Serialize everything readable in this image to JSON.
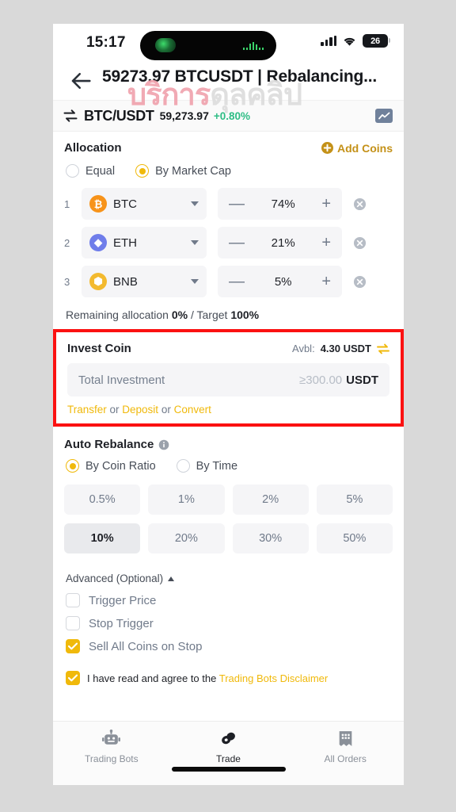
{
  "status_bar": {
    "time": "15:17",
    "battery_level": "26",
    "signal_icon": "cellular-signal-icon",
    "wifi_icon": "wifi-icon",
    "battery_icon": "battery-icon"
  },
  "watermark": {
    "text_primary": "บริการ",
    "text_secondary": "ดุลคลิป"
  },
  "nav": {
    "back_icon": "back-arrow-icon",
    "title": "59273.97 BTCUSDT | Rebalancing..."
  },
  "price_bar": {
    "swap_icon": "swap-arrows-icon",
    "pair": "BTC/USDT",
    "price": "59,273.97",
    "change": "+0.80%",
    "change_color": "#2ebd85",
    "chart_icon": "line-chart-icon"
  },
  "allocation": {
    "title": "Allocation",
    "add_coins_label": "Add Coins",
    "add_coins_icon": "plus-circle-icon",
    "modes": [
      {
        "label": "Equal",
        "selected": false
      },
      {
        "label": "By Market Cap",
        "selected": true
      }
    ],
    "rows": [
      {
        "index": "1",
        "symbol": "BTC",
        "glyph": "₿",
        "color": "#f7931a",
        "percent": "74%"
      },
      {
        "index": "2",
        "symbol": "ETH",
        "glyph": "◆",
        "color": "#6f7dea",
        "percent": "21%"
      },
      {
        "index": "3",
        "symbol": "BNB",
        "glyph": "⬢",
        "color": "#f3ba2f",
        "percent": "5%"
      }
    ],
    "minus_label": "—",
    "plus_label": "+",
    "remove_icon": "remove-circle-icon",
    "dropdown_icon": "chevron-down-icon",
    "remaining_prefix": "Remaining allocation ",
    "remaining_value": "0%",
    "remaining_mid": " / Target ",
    "remaining_target": "100%"
  },
  "invest_coin": {
    "title": "Invest Coin",
    "available_label": "Avbl:",
    "available_value": "4.30 USDT",
    "transfer_icon": "transfer-arrows-icon",
    "input_placeholder": "Total Investment",
    "min_amount": "≥300.00",
    "unit": "USDT",
    "link_transfer": "Transfer",
    "or_1": " or ",
    "link_deposit": "Deposit",
    "or_2": " or ",
    "link_convert": "Convert",
    "highlight_color": "#fb1111"
  },
  "auto_rebalance": {
    "title": "Auto Rebalance",
    "info_icon": "info-icon",
    "modes": [
      {
        "label": "By Coin Ratio",
        "selected": true
      },
      {
        "label": "By Time",
        "selected": false
      }
    ],
    "chips": [
      {
        "label": "0.5%",
        "selected": false
      },
      {
        "label": "1%",
        "selected": false
      },
      {
        "label": "2%",
        "selected": false
      },
      {
        "label": "5%",
        "selected": false
      },
      {
        "label": "10%",
        "selected": true
      },
      {
        "label": "20%",
        "selected": false
      },
      {
        "label": "30%",
        "selected": false
      },
      {
        "label": "50%",
        "selected": false
      }
    ]
  },
  "advanced": {
    "title": "Advanced (Optional)",
    "toggle_icon": "chevron-up-icon",
    "checkboxes": [
      {
        "label": "Trigger Price",
        "checked": false
      },
      {
        "label": "Stop Trigger",
        "checked": false
      },
      {
        "label": "Sell All Coins on Stop",
        "checked": true
      }
    ]
  },
  "agreement": {
    "checked": true,
    "text": "I have read and agree to the ",
    "link": "Trading Bots Disclaimer"
  },
  "tabbar": {
    "items": [
      {
        "label": "Trading Bots",
        "icon": "robot-icon",
        "active": false
      },
      {
        "label": "Trade",
        "icon": "coins-icon",
        "active": true
      },
      {
        "label": "All Orders",
        "icon": "orders-icon",
        "active": false
      }
    ]
  },
  "theme": {
    "accent": "#f0b90b",
    "positive": "#2ebd85",
    "text_primary": "#1e2026",
    "text_secondary": "#707a8a",
    "surface": "#f5f5f7"
  }
}
